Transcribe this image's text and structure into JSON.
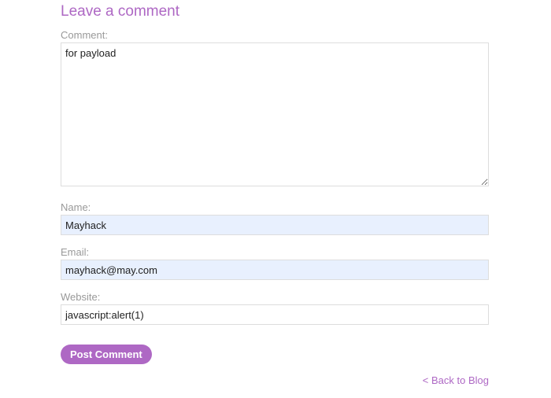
{
  "form": {
    "heading": "Leave a comment",
    "comment_label": "Comment:",
    "comment_value": "for payload",
    "name_label": "Name:",
    "name_value": "Mayhack",
    "email_label": "Email:",
    "email_value": "mayhack@may.com",
    "website_label": "Website:",
    "website_value": "javascript:alert(1)",
    "submit_label": "Post Comment"
  },
  "nav": {
    "back_label": "< Back to Blog"
  },
  "colors": {
    "accent": "#ae68c4",
    "label": "#999999",
    "autofill_bg": "#e8f0fe",
    "border": "#dddddd"
  }
}
